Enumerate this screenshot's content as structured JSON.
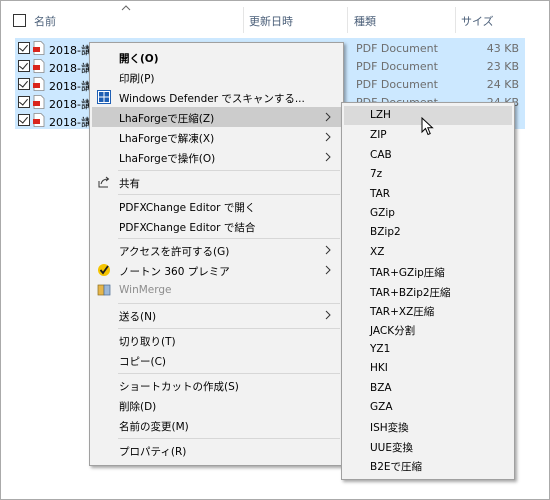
{
  "header": {
    "name_col": "名前",
    "date_col": "更新日時",
    "type_col": "種類",
    "size_col": "サイズ"
  },
  "files": [
    {
      "name": "2018-講",
      "type": "PDF Document",
      "size": "43 KB"
    },
    {
      "name": "2018-講",
      "type": "PDF Document",
      "size": "23 KB"
    },
    {
      "name": "2018-講",
      "type": "PDF Document",
      "size": "24 KB"
    },
    {
      "name": "2018-講",
      "type": "PDF Document",
      "size": "24 KB"
    },
    {
      "name": "2018-講",
      "type": "",
      "size": ""
    }
  ],
  "context_menu": {
    "open": "開く(O)",
    "print": "印刷(P)",
    "defender": "Windows Defender でスキャンする...",
    "lha_compress": "LhaForgeで圧縮(Z)",
    "lha_extract": "LhaForgeで解凍(X)",
    "lha_operate": "LhaForgeで操作(O)",
    "share": "共有",
    "pdfx_open": "PDFXChange Editor で開く",
    "pdfx_combine": "PDFXChange Editor で結合",
    "give_access": "アクセスを許可する(G)",
    "norton": "ノートン 360 プレミア",
    "winmerge": "WinMerge",
    "send_to": "送る(N)",
    "cut": "切り取り(T)",
    "copy": "コピー(C)",
    "create_shortcut": "ショートカットの作成(S)",
    "delete": "削除(D)",
    "rename": "名前の変更(M)",
    "properties": "プロパティ(R)"
  },
  "submenu": [
    "LZH",
    "ZIP",
    "CAB",
    "7z",
    "TAR",
    "GZip",
    "BZip2",
    "XZ",
    "TAR+GZip圧縮",
    "TAR+BZip2圧縮",
    "TAR+XZ圧縮",
    "JACK分割",
    "YZ1",
    "HKI",
    "BZA",
    "GZA",
    "ISH変換",
    "UUE変換",
    "B2Eで圧縮"
  ],
  "colors": {
    "selection": "#cce8ff",
    "menu_bg": "#f2f2f2",
    "highlight": "#cccccc",
    "pdf_red": "#d9251d"
  }
}
